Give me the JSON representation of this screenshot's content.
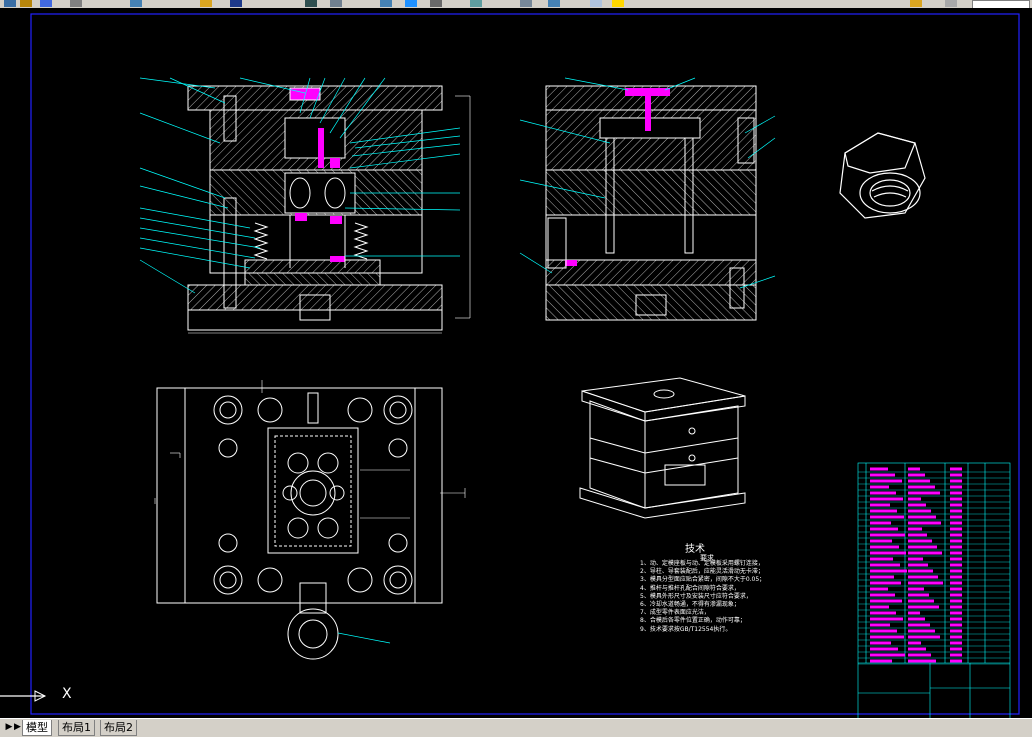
{
  "layout_tabs": [
    {
      "label": "模型",
      "active": true
    },
    {
      "label": "布局1",
      "active": false
    },
    {
      "label": "布局2",
      "active": false
    }
  ],
  "nav_buttons": [
    "▶",
    "▶|"
  ],
  "technical_requirements": {
    "title": "技术",
    "subtitle": "要求",
    "lines": [
      "1、动、定模座板与动、定模板采用螺钉连接，",
      "2、导柱、导套装配后，应能灵活滑动无卡滞；",
      "3、模具分型面应贴合紧密，间隙不大于0.05；",
      "4、推杆与推杆孔配合间隙符合要求，",
      "5、模具外形尺寸及安装尺寸应符合要求，",
      "6、冷却水道畅通，不得有渗漏现象；",
      "7、成型零件表面应光洁，",
      "8、合模后各零件位置正确，动作可靠；",
      "9、技术要求按GB/T12554执行。"
    ]
  },
  "axis_label": "X",
  "colors": {
    "background": "#000000",
    "outline": "#ffffff",
    "hatch": "#ffffff",
    "leader": "#00ffff",
    "highlight": "#ff00ff",
    "border": "#0000ff",
    "table_line": "#00ffff"
  }
}
